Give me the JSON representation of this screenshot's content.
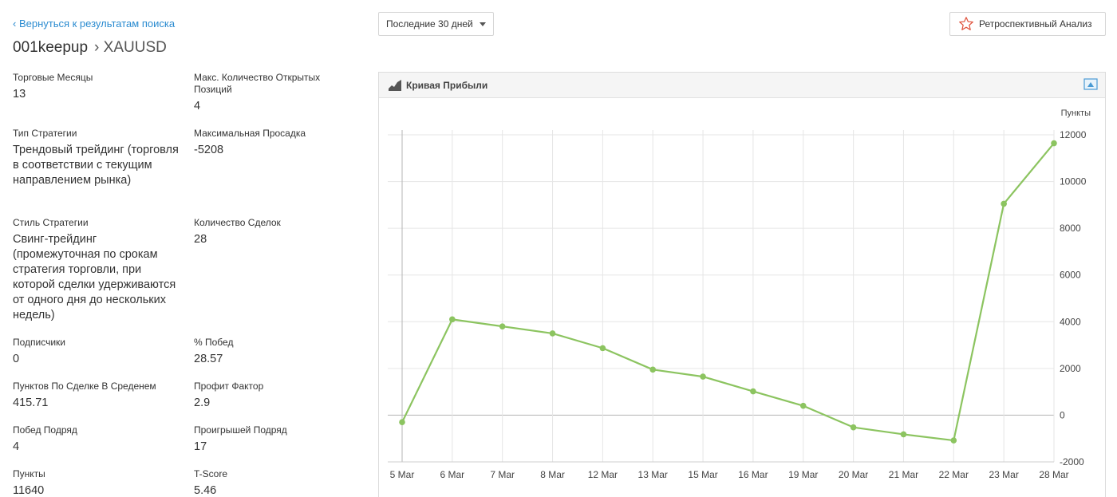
{
  "back_link": "‹ Вернуться к результатам поиска",
  "title": {
    "name": "001keepup",
    "symbol": "› XAUUSD"
  },
  "period": {
    "selected": "Последние 30 дней"
  },
  "retro_button": {
    "label": "Ретроспективный Анализ",
    "icon": "star-outline-icon"
  },
  "stats": [
    {
      "label": "Торговые Месяцы",
      "value": "13"
    },
    {
      "label": "Макс. Количество Открытых Позиций",
      "value": "4"
    },
    {
      "label": "Тип Стратегии",
      "value": "Трендовый трейдинг (торговля в соответствии с текущим направлением рынка)"
    },
    {
      "label": "Максимальная Просадка",
      "value": "-5208"
    },
    {
      "label": "Стиль Стратегии",
      "value": "Свинг-трейдинг (промежуточная по срокам стратегия торговли, при которой сделки удерживаются от одного дня до нескольких недель)"
    },
    {
      "label": "Количество Сделок",
      "value": "28"
    },
    {
      "label": "Подписчики",
      "value": "0"
    },
    {
      "label": "% Побед",
      "value": "28.57"
    },
    {
      "label": "Пунктов По Сделке В Среденем",
      "value": "415.71"
    },
    {
      "label": "Профит Фактор",
      "value": "2.9"
    },
    {
      "label": "Побед Подряд",
      "value": "4"
    },
    {
      "label": "Проигрышей Подряд",
      "value": "17"
    },
    {
      "label": "Пункты",
      "value": "11640"
    },
    {
      "label": "T-Score",
      "value": "5.46"
    }
  ],
  "chart_panel": {
    "title": "Кривая Прибыли",
    "icon": "area-chart-icon",
    "expand_icon": "expand-icon"
  },
  "chart_data": {
    "type": "line",
    "title": "Кривая Прибыли",
    "ylabel": "Пункты",
    "x": [
      "5 Mar",
      "6 Mar",
      "7 Mar",
      "8 Mar",
      "12 Mar",
      "13 Mar",
      "15 Mar",
      "16 Mar",
      "19 Mar",
      "20 Mar",
      "21 Mar",
      "22 Mar",
      "23 Mar",
      "28 Mar"
    ],
    "series": [
      {
        "values": [
          -300,
          4100,
          3800,
          3500,
          2870,
          1950,
          1650,
          1020,
          400,
          -520,
          -820,
          -1080,
          9050,
          11640
        ]
      }
    ],
    "y_ticks": [
      12000,
      10000,
      8000,
      6000,
      4000,
      2000,
      0,
      -2000
    ],
    "ylim": [
      -2000,
      12000
    ],
    "grid": true,
    "color": "#8cc460"
  }
}
